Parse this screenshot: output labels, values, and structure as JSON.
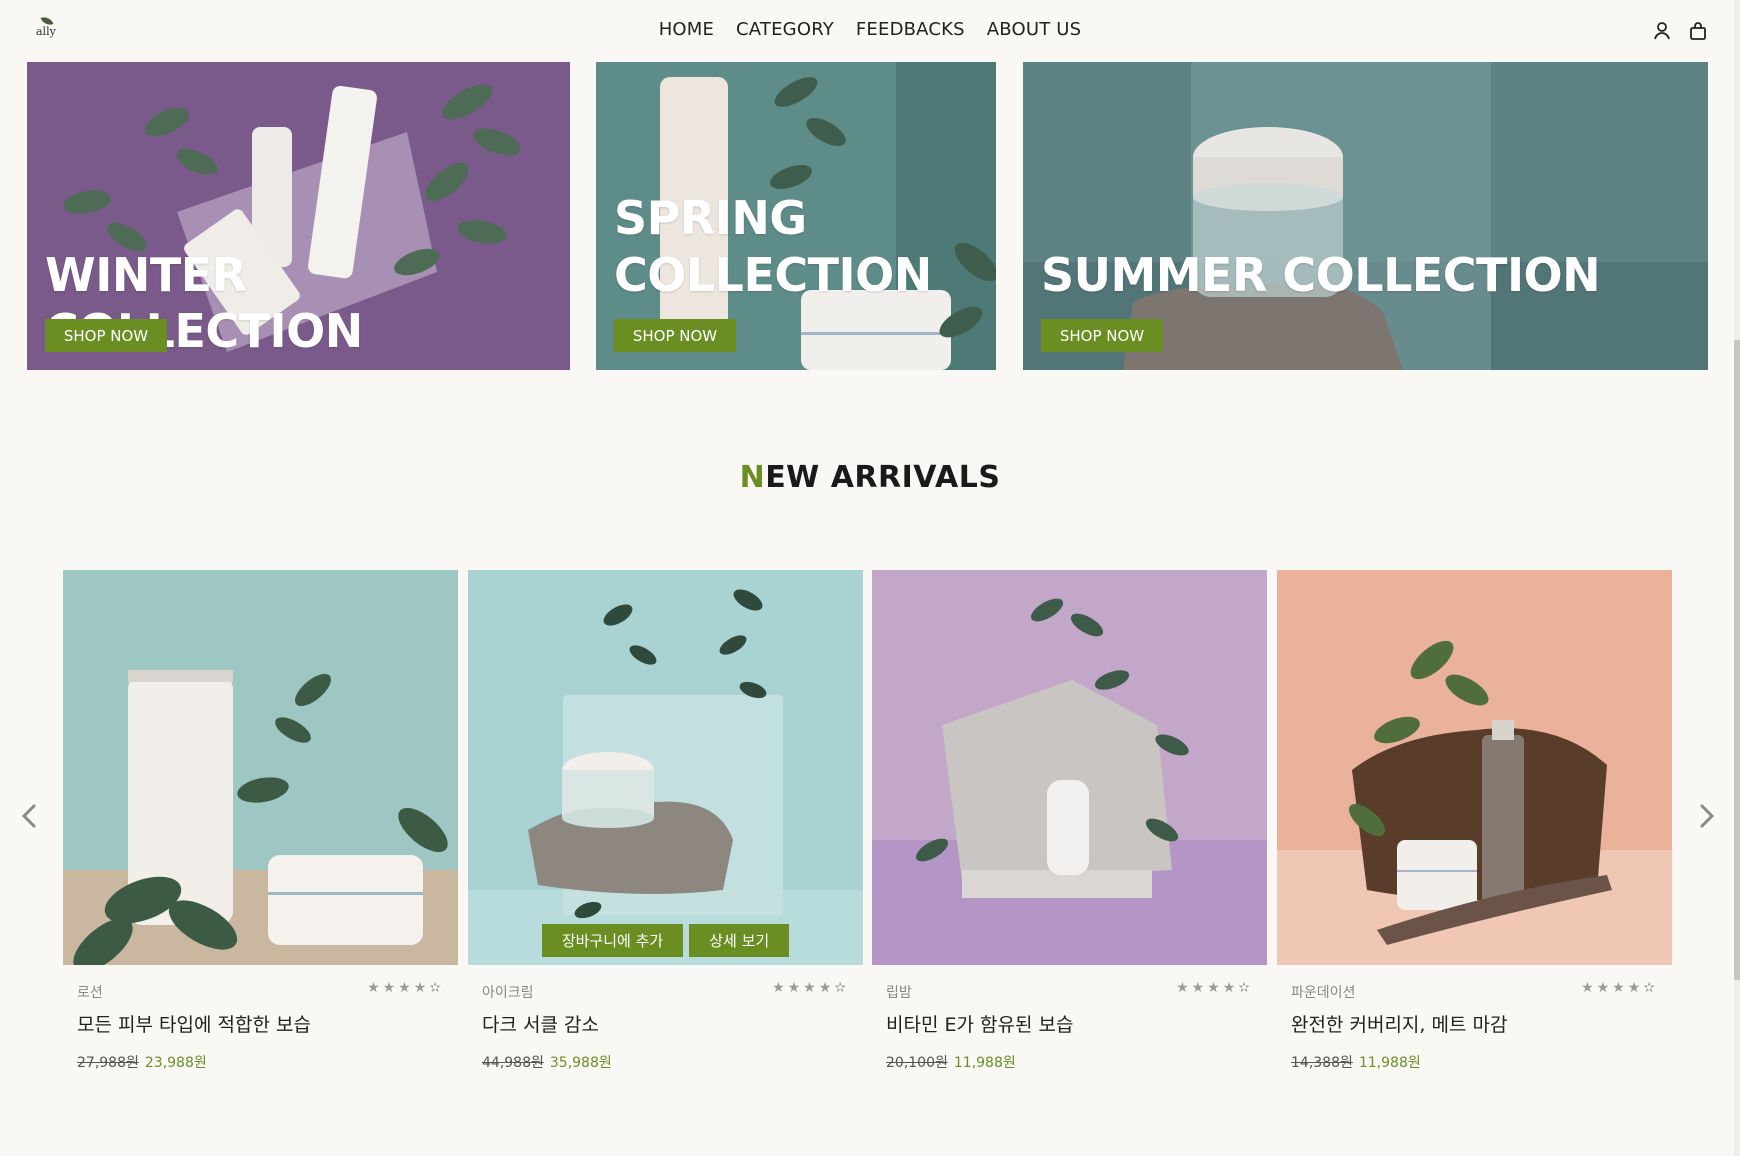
{
  "header": {
    "logo_text": "ally",
    "nav": [
      "HOME",
      "CATEGORY",
      "FEEDBACKS",
      "ABOUT US"
    ],
    "icons": [
      "user-icon",
      "shopping-bag-icon"
    ]
  },
  "banners": [
    {
      "title_lines": [
        "WINTER COLLECTION"
      ],
      "button": "SHOP NOW",
      "color": "#7a5a8a"
    },
    {
      "title_lines": [
        "SPRING",
        "COLLECTION"
      ],
      "button": "SHOP NOW",
      "color": "#5e8c88"
    },
    {
      "title_lines": [
        "SUMMER COLLECTION"
      ],
      "button": "SHOP NOW",
      "color": "#5c8284"
    }
  ],
  "new_arrivals": {
    "title_first_letter": "N",
    "title_rest": "EW ARRIVALS",
    "products": [
      {
        "category": "로션",
        "name": "모든 피부 타입에 적합한 보습",
        "old_price": "27,988원",
        "new_price": "23,988원",
        "stars": "★★★★✫",
        "bg": "#9ec6c2"
      },
      {
        "category": "아이크림",
        "name": "다크 서클 감소",
        "old_price": "44,988원",
        "new_price": "35,988원",
        "stars": "★★★★✫",
        "bg": "#a9d3d3",
        "hover_buttons": [
          "장바구니에 추가",
          "상세 보기"
        ]
      },
      {
        "category": "립밤",
        "name": "비타민 E가 함유된 보습",
        "old_price": "20,100원",
        "new_price": "11,988원",
        "stars": "★★★★✫",
        "bg": "#c3a7c9"
      },
      {
        "category": "파운데이션",
        "name": "완전한 커버리지, 메트 마감",
        "old_price": "14,388원",
        "new_price": "11,988원",
        "stars": "★★★★✫",
        "bg": "#eab29a"
      }
    ]
  },
  "carousel": {
    "prev_icon": "chevron-left-icon",
    "next_icon": "chevron-right-icon"
  },
  "colors": {
    "accent": "#6b8e23",
    "background": "#faf8f4"
  }
}
